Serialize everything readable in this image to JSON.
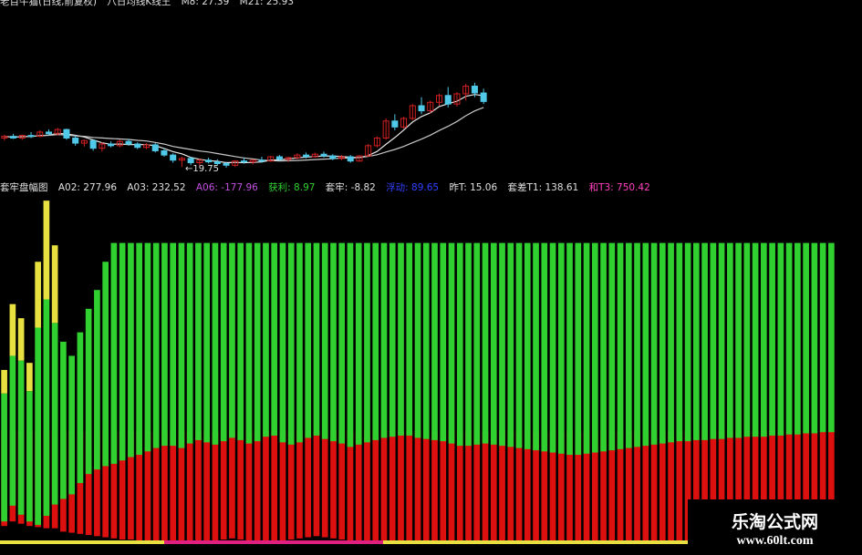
{
  "colors": {
    "background": "#000000",
    "candle_up": "#d02020",
    "candle_down": "#50c8e8",
    "ma_short": "#e8e8e8",
    "ma_long": "#c8c8c8",
    "profit_green": "#30d030",
    "trapped_red": "#dd1010",
    "overflow_yellow": "#e8e040",
    "magenta_bar": "#e02080"
  },
  "header_top": {
    "title": "老百牛猫(日线,前复权)",
    "ma_label": "八日均线K线王",
    "m8": "M8: 27.39",
    "m21": "M21: 25.93"
  },
  "header_mid": {
    "title": "套牢盘幅图",
    "a02": "A02: 277.96",
    "a03": "A03: 232.52",
    "a06": "A06: -177.96",
    "profit": "获利: 8.97",
    "trapped": "套牢: -8.82",
    "float_label": "浮动: 89.65",
    "prev": "昨T: 15.06",
    "gap": "套差T1: 138.61",
    "t3": "和T3: 750.42"
  },
  "low_label": "←19.75",
  "watermark": {
    "title": "乐淘公式网",
    "url": "www.60lt.com"
  },
  "chart_data": {
    "type": "candlestick+bar",
    "price_chart": {
      "ylim": [
        18,
        33
      ],
      "low_marker": 19.75,
      "candles": [
        [
          23.2,
          23.6,
          22.9,
          23.4
        ],
        [
          23.4,
          23.7,
          23.1,
          23.2
        ],
        [
          23.2,
          23.6,
          23.0,
          23.5
        ],
        [
          23.5,
          23.9,
          23.2,
          23.4
        ],
        [
          23.4,
          24.1,
          23.3,
          23.9
        ],
        [
          23.9,
          24.2,
          23.5,
          23.7
        ],
        [
          23.7,
          24.4,
          23.5,
          24.2
        ],
        [
          24.2,
          24.3,
          23.0,
          23.2
        ],
        [
          23.2,
          23.5,
          22.3,
          22.6
        ],
        [
          22.6,
          23.0,
          22.2,
          22.9
        ],
        [
          22.9,
          23.0,
          21.7,
          22.0
        ],
        [
          22.0,
          22.7,
          21.6,
          22.5
        ],
        [
          22.5,
          22.8,
          22.1,
          22.3
        ],
        [
          22.3,
          23.0,
          22.1,
          22.8
        ],
        [
          22.8,
          23.1,
          22.3,
          22.5
        ],
        [
          22.5,
          22.7,
          21.9,
          22.1
        ],
        [
          22.1,
          22.6,
          21.9,
          22.4
        ],
        [
          22.4,
          22.6,
          21.5,
          21.7
        ],
        [
          21.7,
          22.0,
          21.0,
          21.2
        ],
        [
          21.2,
          21.4,
          20.3,
          20.6
        ],
        [
          20.6,
          21.0,
          19.8,
          20.8
        ],
        [
          20.8,
          21.0,
          20.0,
          20.3
        ],
        [
          20.3,
          20.8,
          19.9,
          20.6
        ],
        [
          20.6,
          20.9,
          20.2,
          20.4
        ],
        [
          20.4,
          20.7,
          20.0,
          20.2
        ],
        [
          20.2,
          20.4,
          19.7,
          20.0
        ],
        [
          20.0,
          20.6,
          19.8,
          20.5
        ],
        [
          20.5,
          20.9,
          20.2,
          20.4
        ],
        [
          20.4,
          20.7,
          20.1,
          20.6
        ],
        [
          20.6,
          21.0,
          20.3,
          20.5
        ],
        [
          20.5,
          21.1,
          20.4,
          21.0
        ],
        [
          21.0,
          21.2,
          20.5,
          20.7
        ],
        [
          20.7,
          21.0,
          20.4,
          20.9
        ],
        [
          20.9,
          21.4,
          20.7,
          21.2
        ],
        [
          21.2,
          21.5,
          20.8,
          21.0
        ],
        [
          21.0,
          21.5,
          20.9,
          21.3
        ],
        [
          21.3,
          21.6,
          20.9,
          21.1
        ],
        [
          21.1,
          21.3,
          20.6,
          20.8
        ],
        [
          20.8,
          21.2,
          20.6,
          21.0
        ],
        [
          21.0,
          21.2,
          20.3,
          20.5
        ],
        [
          20.5,
          21.2,
          20.4,
          21.1
        ],
        [
          21.1,
          22.5,
          21.0,
          22.3
        ],
        [
          22.3,
          23.4,
          22.1,
          23.2
        ],
        [
          23.2,
          25.5,
          23.0,
          25.2
        ],
        [
          25.2,
          26.0,
          24.1,
          24.5
        ],
        [
          24.5,
          25.7,
          24.3,
          25.5
        ],
        [
          25.5,
          27.2,
          25.3,
          27.0
        ],
        [
          27.0,
          28.0,
          26.0,
          26.4
        ],
        [
          26.4,
          27.6,
          26.1,
          27.4
        ],
        [
          27.4,
          28.4,
          27.0,
          28.2
        ],
        [
          28.2,
          29.2,
          26.8,
          27.2
        ],
        [
          27.2,
          28.6,
          26.9,
          28.4
        ],
        [
          28.4,
          29.6,
          27.6,
          29.3
        ],
        [
          29.3,
          29.7,
          28.0,
          28.5
        ],
        [
          28.5,
          29.0,
          27.2,
          27.5
        ]
      ]
    },
    "bar_chart": {
      "ylim": [
        -100,
        100
      ],
      "series": [
        {
          "values": [
            -84,
            -80,
            -82,
            -84,
            -85,
            -86,
            -86,
            -89,
            -90,
            -91,
            -92,
            -93,
            -94,
            -95,
            -96,
            -96,
            -97,
            -98,
            -99,
            -100,
            -100,
            -99,
            -100,
            -99,
            -98,
            -97,
            -96,
            -95,
            -96,
            -97,
            -98,
            -99,
            -98,
            -97,
            -96,
            -95,
            -94,
            -93,
            -94,
            -95,
            -96,
            -97,
            -98,
            -98,
            -99,
            -100,
            -100,
            -100,
            -99,
            -100,
            -100,
            -100,
            -100,
            -100,
            -100,
            -100,
            -100,
            -100,
            -100,
            -100,
            -100,
            -100,
            -100,
            -100,
            -100,
            -100,
            -100,
            -100,
            -100,
            -100,
            -100,
            -100,
            -100,
            -100,
            -100,
            -100,
            -100,
            -100,
            -100,
            -100,
            -100,
            -100,
            -100,
            -100,
            -100,
            -100,
            -100,
            -100,
            -100,
            -100,
            -100,
            -100,
            -100,
            -100,
            -100,
            -100,
            -100,
            -100,
            -100
          ]
        },
        {
          "values": [
            -80,
            -66,
            -74,
            -80,
            -83,
            -75,
            -65,
            -60,
            -56,
            -46,
            -38,
            -34,
            -31,
            -29,
            -26,
            -23,
            -21,
            -18,
            -15,
            -13,
            -13,
            -15,
            -11,
            -8,
            -10,
            -12,
            -9,
            -6,
            -8,
            -11,
            -9,
            -5,
            -4,
            -10,
            -12,
            -10,
            -6,
            -4,
            -7,
            -9,
            -11,
            -14,
            -12,
            -10,
            -8,
            -6,
            -5,
            -4,
            -4,
            -6,
            -7,
            -8,
            -9,
            -11,
            -13,
            -13,
            -12,
            -11,
            -12,
            -13,
            -14,
            -15,
            -16,
            -17,
            -18,
            -19,
            -20,
            -21,
            -21,
            -20,
            -19,
            -18,
            -17,
            -16,
            -15,
            -14,
            -13,
            -12,
            -11,
            -10,
            -9,
            -9,
            -8,
            -8,
            -7,
            -7,
            -6,
            -6,
            -5,
            -5,
            -5,
            -4,
            -4,
            -3,
            -3,
            -2,
            -2,
            -1,
            -1
          ]
        },
        {
          "values": [
            10,
            22,
            18,
            12,
            28,
            42,
            33,
            0,
            0,
            0,
            0,
            0,
            0,
            0,
            0,
            0,
            0,
            0,
            0,
            0,
            0,
            0,
            0,
            0,
            0,
            0,
            0,
            0,
            0,
            0,
            0,
            0,
            0,
            0,
            0,
            0,
            0,
            0,
            0,
            0,
            0,
            0,
            0,
            0,
            0,
            0,
            0,
            0,
            0,
            0,
            0,
            0,
            0,
            0,
            0,
            0,
            0,
            0,
            0,
            0,
            0,
            0,
            0,
            0,
            0,
            0,
            0,
            0,
            0,
            0,
            0,
            0,
            0,
            0,
            0,
            0,
            0,
            0,
            0,
            0,
            0,
            0,
            0,
            0,
            0,
            0,
            0,
            0,
            0,
            0,
            0,
            0,
            0,
            0,
            0,
            0,
            0,
            0,
            0
          ]
        },
        {
          "values": [
            16,
            32,
            30,
            17,
            44,
            56,
            46,
            38,
            32,
            42,
            52,
            60,
            72,
            80,
            80,
            80,
            80,
            80,
            80,
            80,
            80,
            80,
            80,
            80,
            80,
            80,
            80,
            80,
            80,
            80,
            80,
            80,
            80,
            80,
            80,
            80,
            80,
            80,
            80,
            80,
            80,
            80,
            80,
            80,
            80,
            80,
            80,
            80,
            80,
            80,
            80,
            80,
            80,
            80,
            80,
            80,
            80,
            80,
            80,
            80,
            80,
            80,
            80,
            80,
            80,
            80,
            80,
            80,
            80,
            80,
            80,
            80,
            80,
            80,
            80,
            80,
            80,
            80,
            80,
            80,
            80,
            80,
            80,
            80,
            80,
            80,
            80,
            80,
            80,
            80,
            80,
            80,
            80,
            80,
            80,
            80,
            80,
            80,
            80
          ]
        },
        {
          "values": [
            0,
            0,
            0,
            0,
            0,
            0,
            0,
            0,
            0,
            0,
            0,
            0,
            0,
            0,
            0,
            0,
            0,
            0,
            0,
            0,
            0,
            0,
            0,
            0,
            0,
            0,
            0,
            0,
            0,
            0,
            0,
            0,
            0,
            0,
            0,
            0,
            0,
            0,
            0,
            0,
            0,
            0,
            0,
            0,
            0,
            0,
            0,
            0,
            0,
            0,
            0,
            0,
            0,
            0,
            0,
            0,
            0,
            0,
            0,
            0,
            0,
            0,
            0,
            0,
            0,
            0,
            0,
            0,
            0,
            0,
            0,
            0,
            0,
            0,
            0,
            0,
            0,
            0,
            0,
            0,
            0,
            0,
            0,
            0,
            0,
            0,
            0,
            0,
            0,
            0,
            0,
            0,
            0,
            0,
            0,
            0,
            0,
            0,
            0
          ]
        }
      ]
    }
  }
}
